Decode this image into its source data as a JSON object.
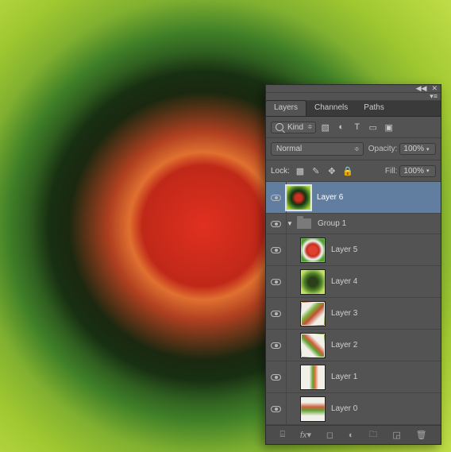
{
  "panel": {
    "tabs": [
      "Layers",
      "Channels",
      "Paths"
    ],
    "active_tab": 0,
    "filter": {
      "kind_label": "Kind"
    },
    "blend": {
      "mode": "Normal",
      "opacity_label": "Opacity:",
      "opacity_value": "100%"
    },
    "lock": {
      "label": "Lock:",
      "fill_label": "Fill:",
      "fill_value": "100%"
    },
    "layers": [
      {
        "name": "Layer 6",
        "type": "layer",
        "visible": true,
        "depth": 0,
        "selected": true,
        "thumb": "th6"
      },
      {
        "name": "Group 1",
        "type": "group",
        "visible": true,
        "depth": 0,
        "expanded": true
      },
      {
        "name": "Layer 5",
        "type": "layer",
        "visible": true,
        "depth": 1,
        "thumb": "th5"
      },
      {
        "name": "Layer 4",
        "type": "layer",
        "visible": true,
        "depth": 1,
        "thumb": "th4"
      },
      {
        "name": "Layer 3",
        "type": "layer",
        "visible": true,
        "depth": 1,
        "thumb": "th3"
      },
      {
        "name": "Layer 2",
        "type": "layer",
        "visible": true,
        "depth": 1,
        "thumb": "th2"
      },
      {
        "name": "Layer 1",
        "type": "layer",
        "visible": true,
        "depth": 1,
        "thumb": "th1"
      },
      {
        "name": "Layer 0",
        "type": "layer",
        "visible": true,
        "depth": 1,
        "thumb": "th0"
      }
    ]
  }
}
